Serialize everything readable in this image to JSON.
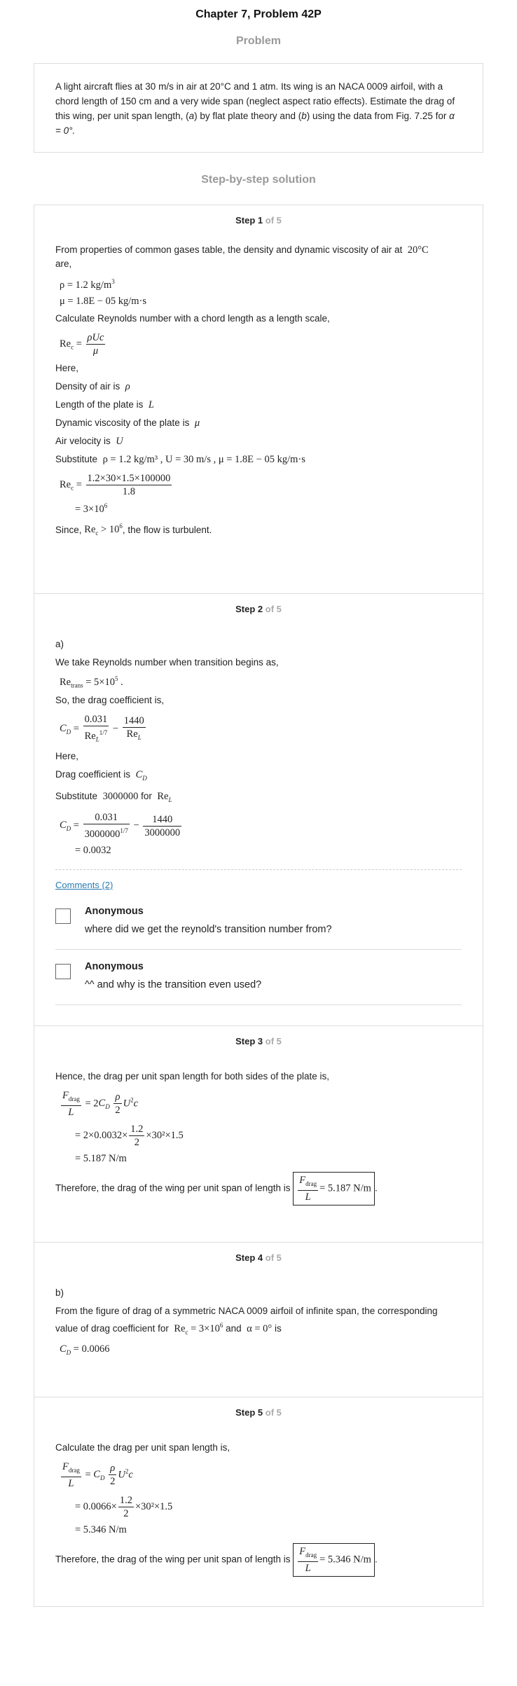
{
  "title": "Chapter 7, Problem 42P",
  "problem_heading": "Problem",
  "problem_text_pre": "A light aircraft flies at 30 m/s in air at 20°C and 1 atm. Its wing is an NACA 0009 airfoil, with a chord length of 150 cm and a very wide span (neglect aspect ratio effects). Estimate the drag of this wing, per unit span length, (",
  "problem_text_a": "a",
  "problem_text_mid": ") by flat plate theory and (",
  "problem_text_b": "b",
  "problem_text_post": ") using the data from Fig. 7.25 for ",
  "problem_text_alpha": "α = 0°.",
  "sbs_heading": "Step-by-step solution",
  "step_label": "Step",
  "of_total": "of 5",
  "steps": [
    {
      "num": "1",
      "intro": "From properties of common gases table, the density and dynamic viscosity of air at",
      "temp": "20°C",
      "are": "are,",
      "rho": "ρ = 1.2 kg/m",
      "mu": "μ = 1.8E − 05 kg/m·s",
      "calc_re": "Calculate Reynolds number with a chord length as a length scale,",
      "here": "Here,",
      "density": "Density of air is",
      "length": "Length of the plate is",
      "viscosity": "Dynamic viscosity of the plate is",
      "velocity": "Air velocity is",
      "substitute": "Substitute",
      "sub_vals": "ρ = 1.2 kg/m³ , U = 30 m/s , μ = 1.8E − 05 kg/m·s",
      "re_num": "1.2×30×1.5×100000",
      "re_den": "1.8",
      "re_result": "= 3×10",
      "since": "Since,",
      "since_tail": ", the flow is turbulent."
    },
    {
      "num": "2",
      "part": "a)",
      "take": "We take Reynolds number when transition begins as,",
      "re_trans": "= 5×10",
      "so": "So, the drag coefficient is,",
      "here": "Here,",
      "drag_coef": "Drag coefficient is",
      "substitute": "Substitute",
      "sub_val": "3000000",
      "for": "for",
      "num1": "0.031",
      "num2": "1440",
      "den2": "3000000",
      "result": "= 0.0032",
      "comments_link": "Comments (2)",
      "comments": [
        {
          "author": "Anonymous",
          "text": "where did we get the reynold's transition number from?"
        },
        {
          "author": "Anonymous",
          "text": "^^ and why is the transition even used?"
        }
      ]
    },
    {
      "num": "3",
      "hence": "Hence, the drag per unit span length for both sides of the plate is,",
      "line2": "= 2×0.0032×",
      "line2b": "×30²×1.5",
      "line3": "= 5.187 N/m",
      "therefore": "Therefore, the drag of the wing per unit span of length is",
      "boxed": "= 5.187 N/m"
    },
    {
      "num": "4",
      "part": "b)",
      "text1": "From the figure of drag of a symmetric NACA 0009 airfoil of infinite span, the corresponding value of drag coefficient for",
      "and": "and",
      "alpha": "α = 0°",
      "is": "is",
      "cd": "= 0.0066"
    },
    {
      "num": "5",
      "calc": "Calculate the drag per unit span length is,",
      "line2": "= 0.0066×",
      "line2b": "×30²×1.5",
      "line3": "= 5.346 N/m",
      "therefore": "Therefore, the drag of the wing per unit span of length is",
      "boxed": "= 5.346 N/m"
    }
  ]
}
